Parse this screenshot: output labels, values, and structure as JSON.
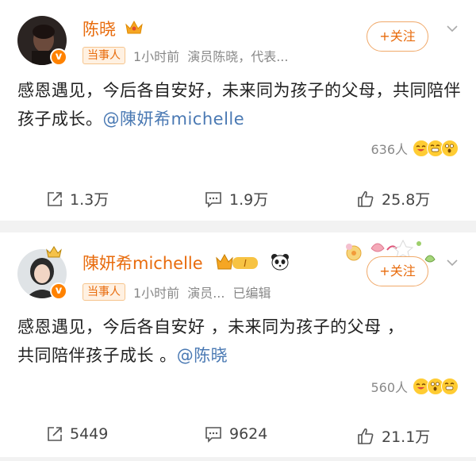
{
  "posts": [
    {
      "author": "陈晓",
      "tag": "当事人",
      "time": "1小时前",
      "source": "演员陈晓，代表...",
      "edited": "",
      "follow_label": "+关注",
      "text": "感恩遇见，今后各自安好，未来同为孩子的父母，共同陪伴孩子成长。",
      "mention": "@陳妍希michelle",
      "likes_count": "636人",
      "repost": "1.3万",
      "comment": "1.9万",
      "like": "25.8万"
    },
    {
      "author": "陳妍希michelle",
      "tag": "当事人",
      "time": "1小时前",
      "source": "演员...",
      "edited": "已编辑",
      "follow_label": "+关注",
      "text_line1": "感恩遇见，今后各自安好 ，未来同为孩子的父母 ，",
      "text_line2": "共同陪伴孩子成长 。",
      "mention": "@陈晓",
      "likes_count": "560人",
      "repost": "5449",
      "comment": "9624",
      "like": "21.1万"
    }
  ],
  "colors": {
    "accent": "#e86b0c",
    "mention": "#4a79b3",
    "badge": "#ff8200"
  }
}
